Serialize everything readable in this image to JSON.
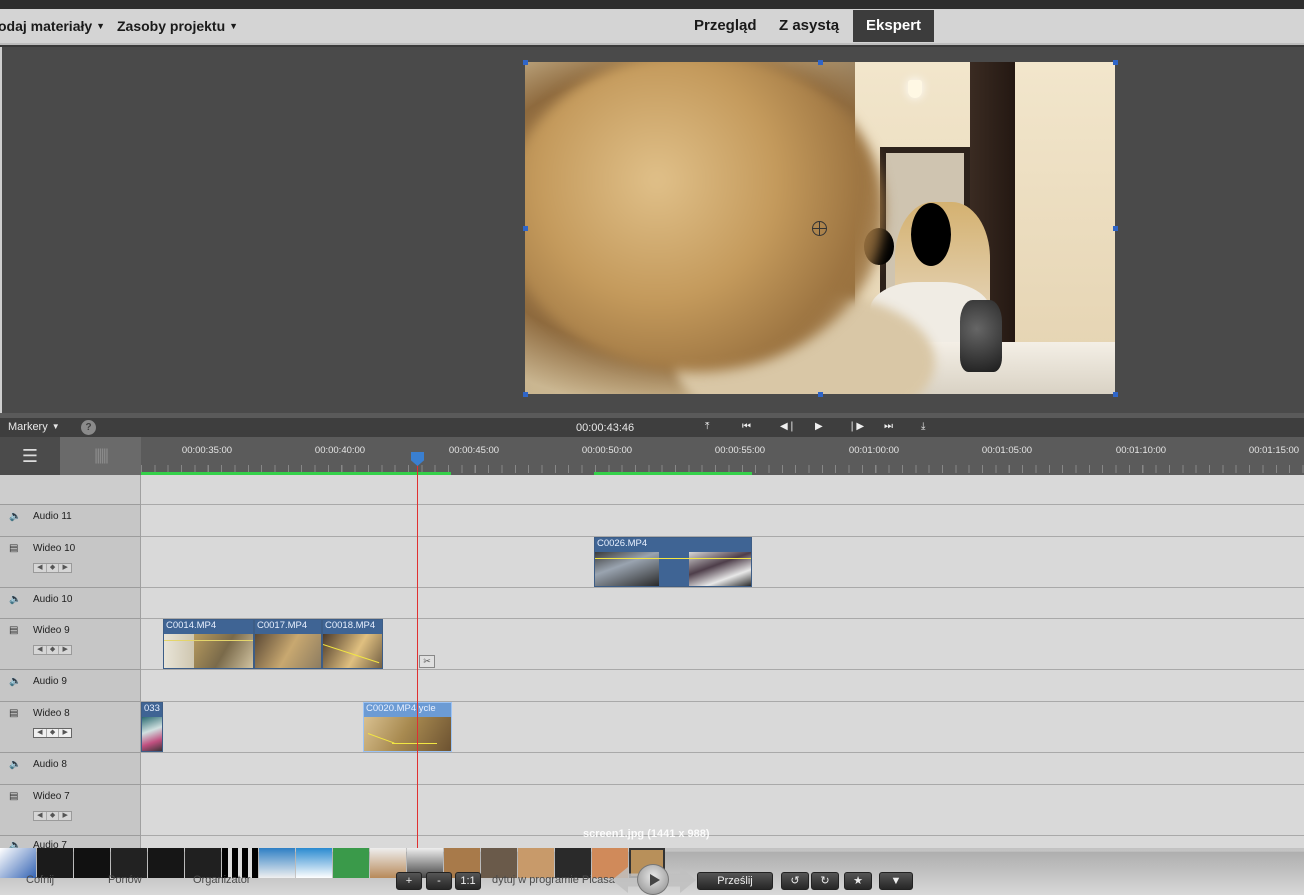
{
  "menus": {
    "add_media": "odaj materiały",
    "project_assets": "Zasoby projektu"
  },
  "modes": [
    "Przegląd",
    "Z asystą",
    "Ekspert"
  ],
  "active_mode": "Ekspert",
  "transport": {
    "markers_label": "Markery",
    "help_glyph": "?",
    "timecode": "00:00:43:46"
  },
  "ruler": {
    "labels": [
      "00:00:35:00",
      "00:00:40:00",
      "00:00:45:00",
      "00:00:50:00",
      "00:00:55:00",
      "00:01:00:00",
      "00:01:05:00",
      "00:01:10:00",
      "00:01:15:00"
    ]
  },
  "tracks": [
    {
      "name": "Audio 11",
      "type": "audio"
    },
    {
      "name": "Wideo 10",
      "type": "video"
    },
    {
      "name": "Audio 10",
      "type": "audio"
    },
    {
      "name": "Wideo 9",
      "type": "video"
    },
    {
      "name": "Audio 9",
      "type": "audio"
    },
    {
      "name": "Wideo 8",
      "type": "video"
    },
    {
      "name": "Audio 8",
      "type": "audio"
    },
    {
      "name": "Wideo 7",
      "type": "video"
    },
    {
      "name": "Audio 7",
      "type": "audio"
    }
  ],
  "clips": {
    "c0026": "C0026.MP4",
    "c0014": "C0014.MP4",
    "c0017": "C0017.MP4",
    "c0018": "C0018.MP4",
    "c0033_partial": "033",
    "c0020": "C0020.MP4 ycle"
  },
  "overlay": {
    "caption": "screen1.jpg (1441 x 988)",
    "btn_plus": "+",
    "btn_minus": "-",
    "btn_ratio": "1:1",
    "edit_text": "dytuj w programie Picasa",
    "share_label": "Prześlij",
    "bottom_left_1": "Cofnij",
    "bottom_left_2": "Ponów",
    "bottom_left_3": "Organizator"
  },
  "colors": {
    "playhead": "#e03030",
    "clip_blue": "#3f6494",
    "active_mode_bg": "#3c3c3c",
    "green_render_bar": "#35d04a"
  }
}
